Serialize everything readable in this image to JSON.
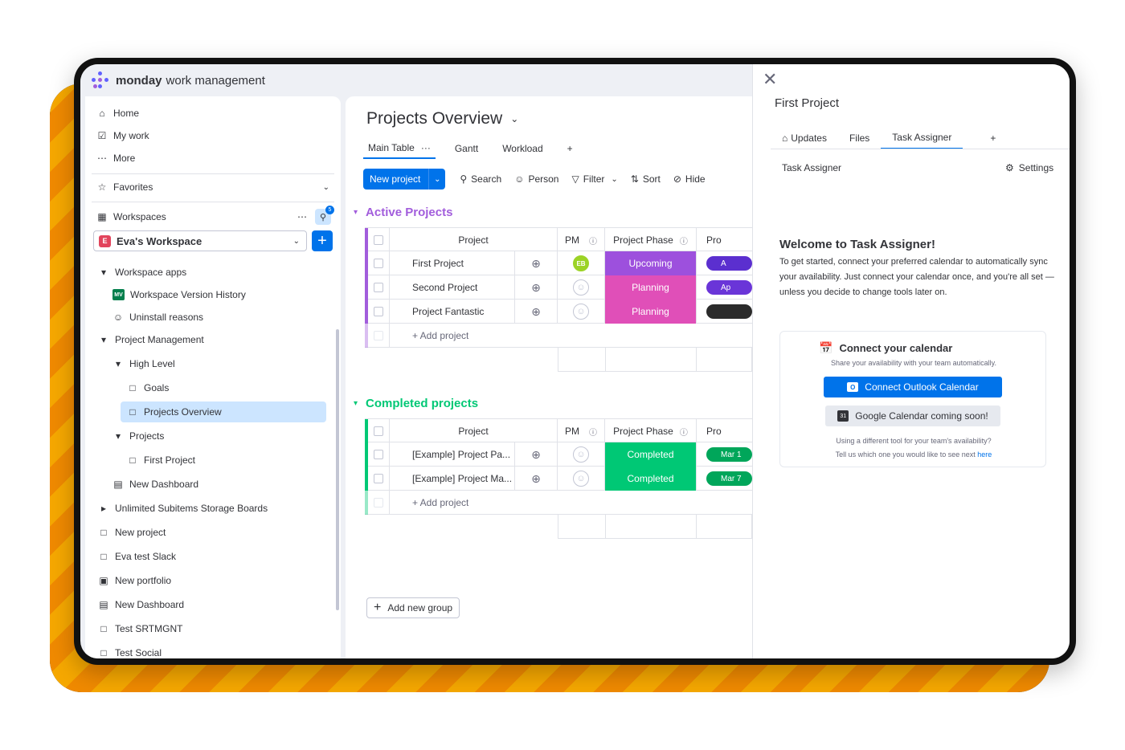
{
  "brand": {
    "name_bold": "monday",
    "name_rest": "work management"
  },
  "sidebar": {
    "home": "Home",
    "my_work": "My work",
    "more": "More",
    "favorites": "Favorites",
    "workspaces": "Workspaces",
    "workspaces_badge": "5",
    "workspace_name": "Eva's Workspace",
    "workspace_badge": "E",
    "tree": [
      {
        "label": "Workspace apps",
        "icon": "caret-down-icon"
      },
      {
        "label": "Workspace Version History",
        "icon": "mv-app-icon",
        "badge": "MV"
      },
      {
        "label": "Uninstall reasons",
        "icon": "survey-icon"
      },
      {
        "label": "Project Management",
        "icon": "caret-down-icon"
      },
      {
        "label": "High Level",
        "icon": "caret-down-icon"
      },
      {
        "label": "Goals",
        "icon": "board-icon"
      },
      {
        "label": "Projects Overview",
        "icon": "board-icon",
        "selected": true
      },
      {
        "label": "Projects",
        "icon": "caret-down-icon"
      },
      {
        "label": "First Project",
        "icon": "board-icon"
      },
      {
        "label": "New Dashboard",
        "icon": "dashboard-icon"
      },
      {
        "label": "Unlimited Subitems Storage Boards",
        "icon": "caret-right-icon"
      },
      {
        "label": "New project",
        "icon": "board-icon"
      },
      {
        "label": "Eva test Slack",
        "icon": "board-icon"
      },
      {
        "label": "New portfolio",
        "icon": "portfolio-icon"
      },
      {
        "label": "New Dashboard",
        "icon": "dashboard-icon"
      },
      {
        "label": "Test SRTMGNT",
        "icon": "board-icon"
      },
      {
        "label": "Test Social",
        "icon": "board-icon"
      }
    ]
  },
  "board": {
    "title": "Projects Overview",
    "tabs": [
      "Main Table",
      "Gantt",
      "Workload"
    ],
    "tab_more": "···",
    "tab_add": "+",
    "toolbar": {
      "new_project": "New project",
      "search": "Search",
      "person": "Person",
      "filter": "Filter",
      "sort": "Sort",
      "hide": "Hide"
    },
    "columns": {
      "project": "Project",
      "pm": "PM",
      "phase": "Project Phase",
      "pro": "Pro"
    },
    "add_project": "+ Add project",
    "add_group": "Add new group",
    "groups": [
      {
        "name": "Active Projects",
        "color": "#a25ddc",
        "rows": [
          {
            "name": "First Project",
            "pm": "EB",
            "phase": "Upcoming",
            "phase_color": "#9d50dd",
            "pill": "A",
            "pill_color": "#5b2fcf"
          },
          {
            "name": "Second Project",
            "pm": "",
            "phase": "Planning",
            "phase_color": "#e04fb8",
            "pill": "Ap",
            "pill_color": "#6a35d8"
          },
          {
            "name": "Project Fantastic",
            "pm": "",
            "phase": "Planning",
            "phase_color": "#e04fb8",
            "pill": "",
            "pill_color": "#2b2b2b"
          }
        ]
      },
      {
        "name": "Completed projects",
        "color": "#00c875",
        "rows": [
          {
            "name": "[Example] Project Pa...",
            "pm": "",
            "phase": "Completed",
            "phase_color": "#00c875",
            "pill": "Mar 1",
            "pill_color": "#00a65a"
          },
          {
            "name": "[Example] Project Ma...",
            "pm": "",
            "phase": "Completed",
            "phase_color": "#00c875",
            "pill": "Mar 7",
            "pill_color": "#00a65a"
          }
        ]
      }
    ]
  },
  "panel": {
    "title": "First Project",
    "tabs": [
      "Updates",
      "Files",
      "Task Assigner"
    ],
    "tab_add": "+",
    "subtitle": "Task Assigner",
    "settings": "Settings",
    "welcome_title": "Welcome to Task Assigner!",
    "welcome_text": "To get started, connect your preferred calendar to automatically sync your availability. Just connect your calendar once, and you're all set — unless you decide to change tools later on.",
    "card": {
      "title": "Connect your calendar",
      "desc": "Share your availability with your team automatically.",
      "outlook": "Connect Outlook Calendar",
      "google": "Google Calendar coming soon!",
      "foot1": "Using a different tool for your team's availability?",
      "foot2": "Tell us which one you would like to see next",
      "link": "here"
    }
  }
}
